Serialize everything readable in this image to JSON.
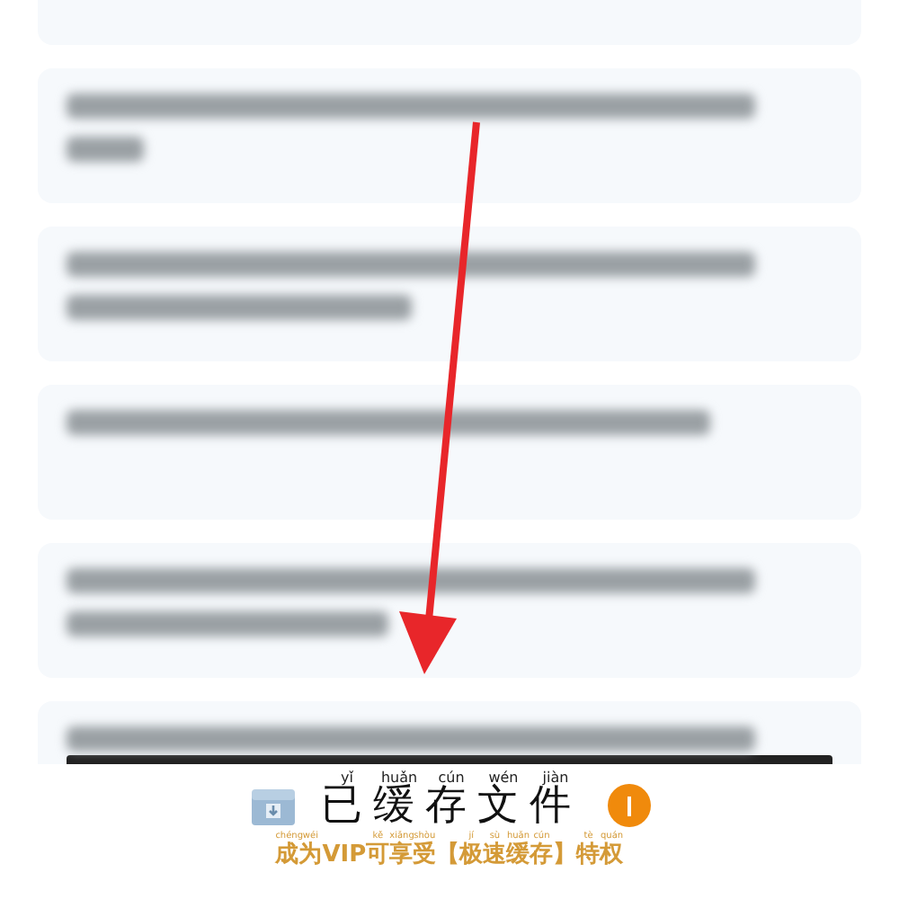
{
  "cache_panel": {
    "title": [
      {
        "char": "已",
        "pinyin": "yǐ"
      },
      {
        "char": "缓",
        "pinyin": "huǎn"
      },
      {
        "char": "存",
        "pinyin": "cún"
      },
      {
        "char": "文",
        "pinyin": "wén"
      },
      {
        "char": "件",
        "pinyin": "jiàn"
      }
    ],
    "promo": [
      {
        "char": "成",
        "pinyin": "chéng"
      },
      {
        "char": "为",
        "pinyin": "wéi"
      },
      {
        "char": "VIP"
      },
      {
        "char": "可",
        "pinyin": "kě"
      },
      {
        "char": "享",
        "pinyin": "xiǎng"
      },
      {
        "char": "受",
        "pinyin": "shòu"
      },
      {
        "char": "【"
      },
      {
        "char": "极",
        "pinyin": "jí"
      },
      {
        "char": "速",
        "pinyin": "sù"
      },
      {
        "char": "缓",
        "pinyin": "huǎn"
      },
      {
        "char": "存",
        "pinyin": "cún"
      },
      {
        "char": "】"
      },
      {
        "char": "特",
        "pinyin": "tè"
      },
      {
        "char": "权",
        "pinyin": "quán"
      }
    ]
  }
}
